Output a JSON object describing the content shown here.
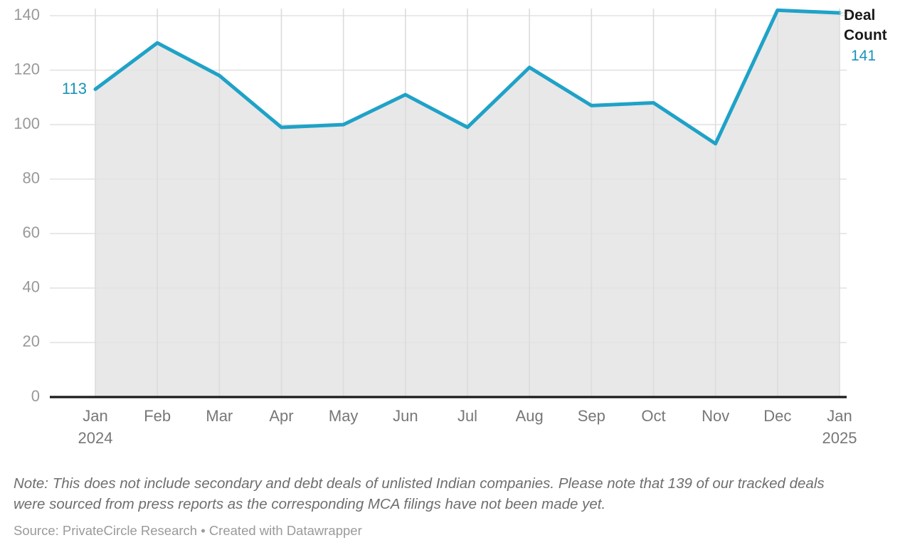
{
  "chart_data": {
    "type": "area",
    "title": "",
    "subtitle": "",
    "xlabel": "",
    "ylabel": "",
    "categories": [
      "Jan",
      "Feb",
      "Mar",
      "Apr",
      "May",
      "Jun",
      "Jul",
      "Aug",
      "Sep",
      "Oct",
      "Nov",
      "Dec",
      "Jan"
    ],
    "category_sublabels": [
      "2024",
      "",
      "",
      "",
      "",
      "",
      "",
      "",
      "",
      "",
      "",
      "",
      "2025"
    ],
    "series": [
      {
        "name": "Deal Count",
        "values": [
          113,
          130,
          118,
          99,
          100,
          111,
          99,
          121,
          107,
          108,
          93,
          142,
          141
        ],
        "color": "#1fa2c8",
        "fill_color": "#e8e8e8"
      }
    ],
    "ylim": [
      0,
      145
    ],
    "y_ticks": [
      0,
      20,
      40,
      60,
      80,
      100,
      120,
      140
    ],
    "y_tick_labels": [
      "0",
      "20",
      "40",
      "60",
      "80",
      "100",
      "120",
      "140"
    ],
    "grid": true,
    "legend_position": "right",
    "first_point_label": "113",
    "last_point_label": "141",
    "axis_baseline_color": "#1a1a1a",
    "gridline_color": "#e0e0e0"
  },
  "legend": {
    "title_line1": "Deal",
    "title_line2": "Count",
    "value": "141"
  },
  "footer": {
    "note": "Note: This does not include secondary and debt deals of unlisted Indian companies. Please note that 139 of our tracked deals were sourced from press reports as the corresponding MCA filings have not been made yet.",
    "source": "Source: PrivateCircle Research • Created with Datawrapper"
  }
}
